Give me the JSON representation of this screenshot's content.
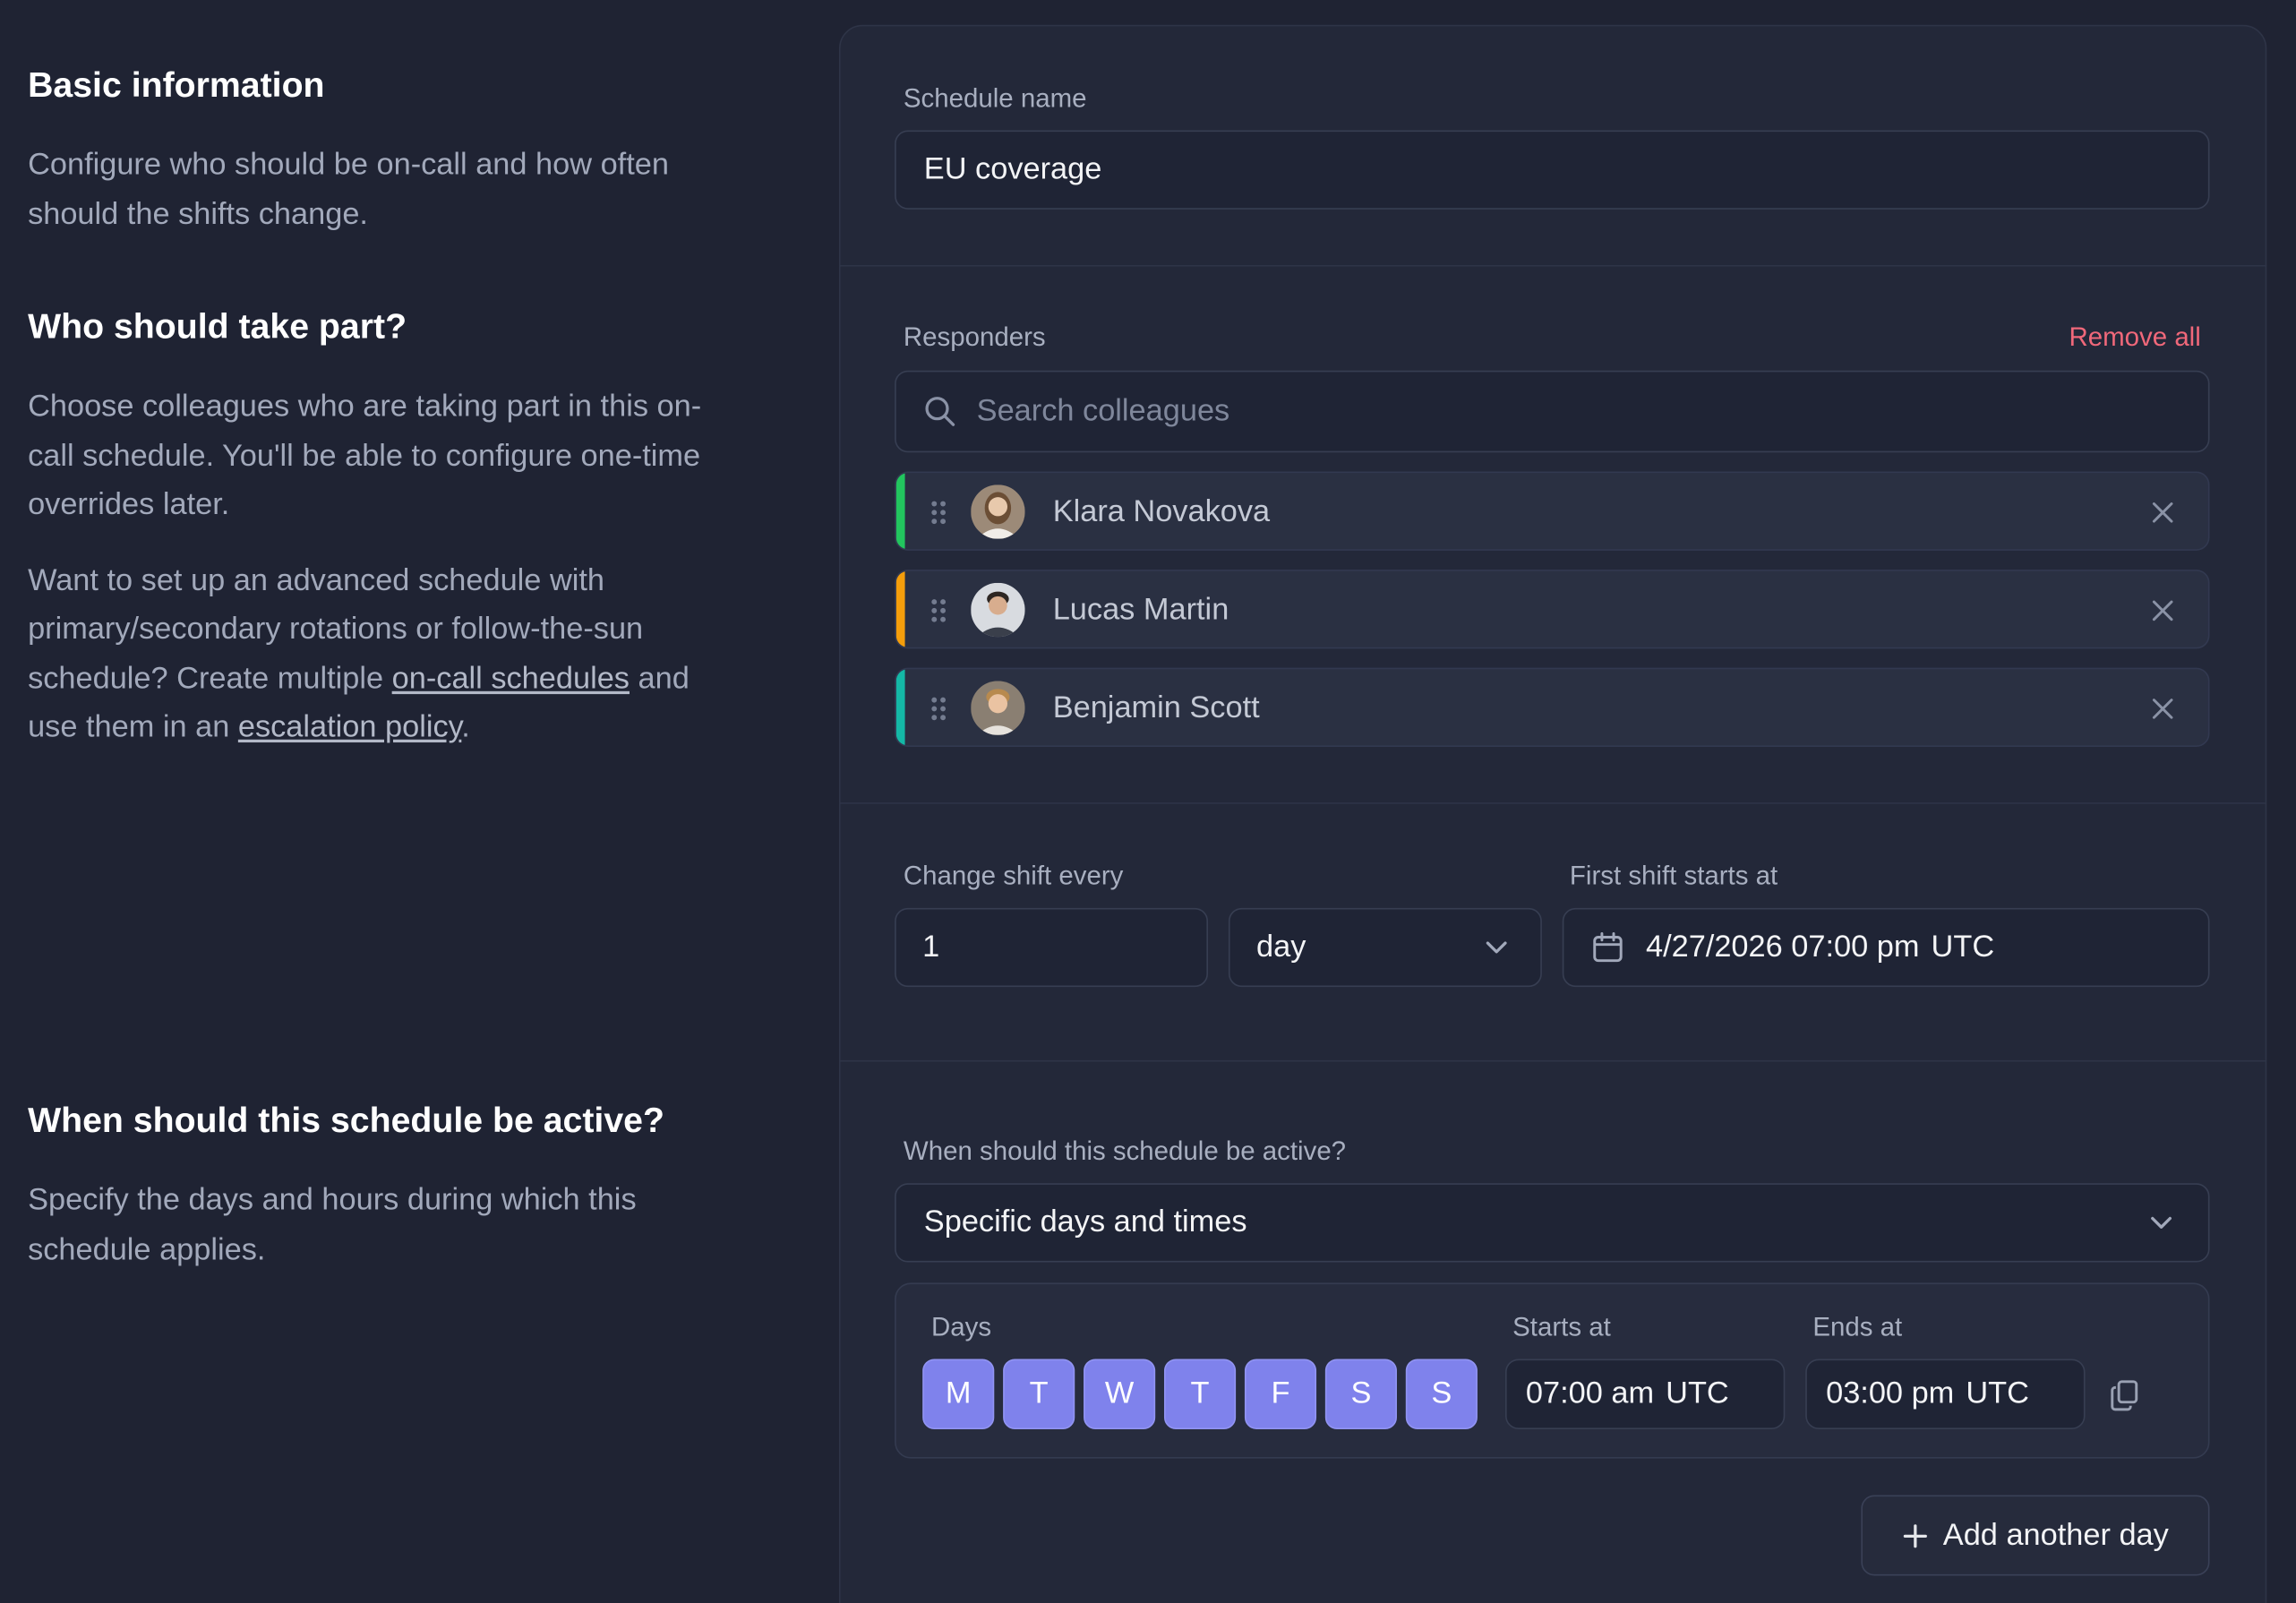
{
  "left": {
    "basic": {
      "title": "Basic information",
      "description": "Configure who should be on-call and how often should the shifts change."
    },
    "who": {
      "title": "Who should take part?",
      "description": "Choose colleagues who are taking part in this on-call schedule. You'll be able to configure one-time overrides later.",
      "advanced_prefix": "Want to set up an advanced schedule with primary/secondary rotations or follow-the-sun schedule? Create multiple ",
      "link_schedules": "on-call schedules",
      "advanced_middle": " and use them in an ",
      "link_policy": "escalation policy",
      "advanced_suffix": "."
    },
    "when": {
      "title": "When should this schedule be active?",
      "description": "Specify the days and hours during which this schedule applies."
    }
  },
  "form": {
    "schedule_name": {
      "label": "Schedule name",
      "value": "EU coverage"
    },
    "responders": {
      "label": "Responders",
      "remove_all": "Remove all",
      "search_placeholder": "Search colleagues",
      "items": [
        {
          "name": "Klara Novakova",
          "color": "#22c55e"
        },
        {
          "name": "Lucas Martin",
          "color": "#f59e0b"
        },
        {
          "name": "Benjamin Scott",
          "color": "#14b8a6"
        }
      ]
    },
    "shift": {
      "change_label": "Change shift every",
      "interval_value": "1",
      "unit_value": "day",
      "first_label": "First shift starts at",
      "first_value": "4/27/2026 07:00 pm",
      "first_tz": "UTC"
    },
    "active": {
      "label": "When should this schedule be active?",
      "mode": "Specific days and times",
      "days_label": "Days",
      "days": [
        "M",
        "T",
        "W",
        "T",
        "F",
        "S",
        "S"
      ],
      "starts_label": "Starts at",
      "starts_time": "07:00 am",
      "starts_tz": "UTC",
      "ends_label": "Ends at",
      "ends_time": "03:00 pm",
      "ends_tz": "UTC",
      "add_day": "Add another day"
    }
  },
  "colors": {
    "accent": "#7f82ec",
    "danger": "#f0687a",
    "background": "#1f2333",
    "card": "#232839"
  }
}
